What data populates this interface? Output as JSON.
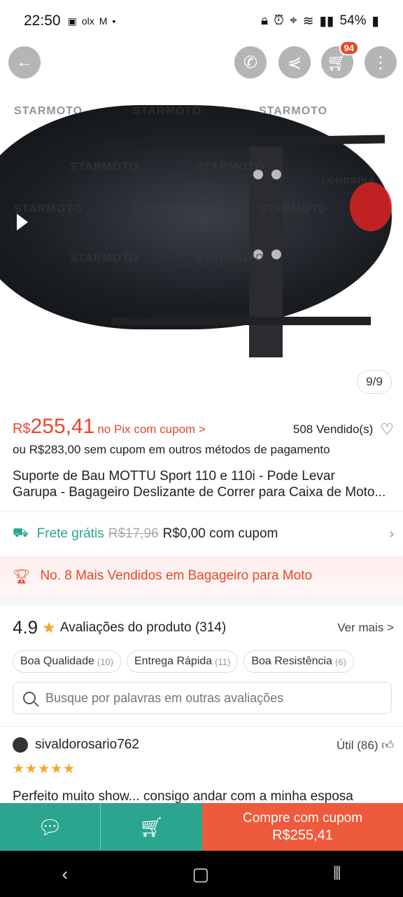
{
  "status_bar": {
    "time": "22:50",
    "app_icons": [
      "image-icon",
      "olx-icon",
      "gmail-icon",
      "dot-icon"
    ],
    "olx_text": "olx",
    "battery": "54%"
  },
  "image_viewer": {
    "counter": "9/9",
    "watermark": "STARMOTO",
    "watermark_sub": "LONDRINA"
  },
  "header": {
    "cart_badge": "94"
  },
  "price": {
    "currency": "R$",
    "value": "255,41",
    "pix_label": "no Pix com cupom >",
    "sold": "508 Vendido(s)",
    "alt_text": "ou R$283,00 sem cupom em outros métodos de pagamento"
  },
  "product": {
    "title_line1": "Suporte de Bau MOTTU Sport 110 e 110i - Pode Levar",
    "title_line2": "Garupa - Bagageiro Deslizante de Correr para Caixa de Moto..."
  },
  "shipping": {
    "free_label": "Frete grátis",
    "old_price": "R$17,96",
    "coupon_text": "R$0,00 com cupom"
  },
  "bestseller": {
    "text": "No. 8 Mais Vendidos em Bagageiro para Moto"
  },
  "reviews": {
    "rating": "4.9",
    "label": "Avaliações do produto (314)",
    "see_more": "Ver mais >",
    "tags": [
      {
        "label": "Boa Qualidade",
        "count": "(10)"
      },
      {
        "label": "Entrega Rápida",
        "count": "(11)"
      },
      {
        "label": "Boa Resistência",
        "count": "(6)"
      }
    ],
    "search_placeholder": "Busque por palavras em outras avaliações",
    "first": {
      "username": "sivaldorosario762",
      "useful": "Útil (86)",
      "stars": "★★★★★",
      "text": "Perfeito muito show... consigo andar com a  minha esposa"
    }
  },
  "action_bar": {
    "buy_label": "Compre com cupom",
    "buy_price": "R$255,41"
  },
  "colors": {
    "accent_orange": "#e9462c",
    "accent_green": "#2aa58e",
    "buy_button": "#ee5a3c"
  }
}
